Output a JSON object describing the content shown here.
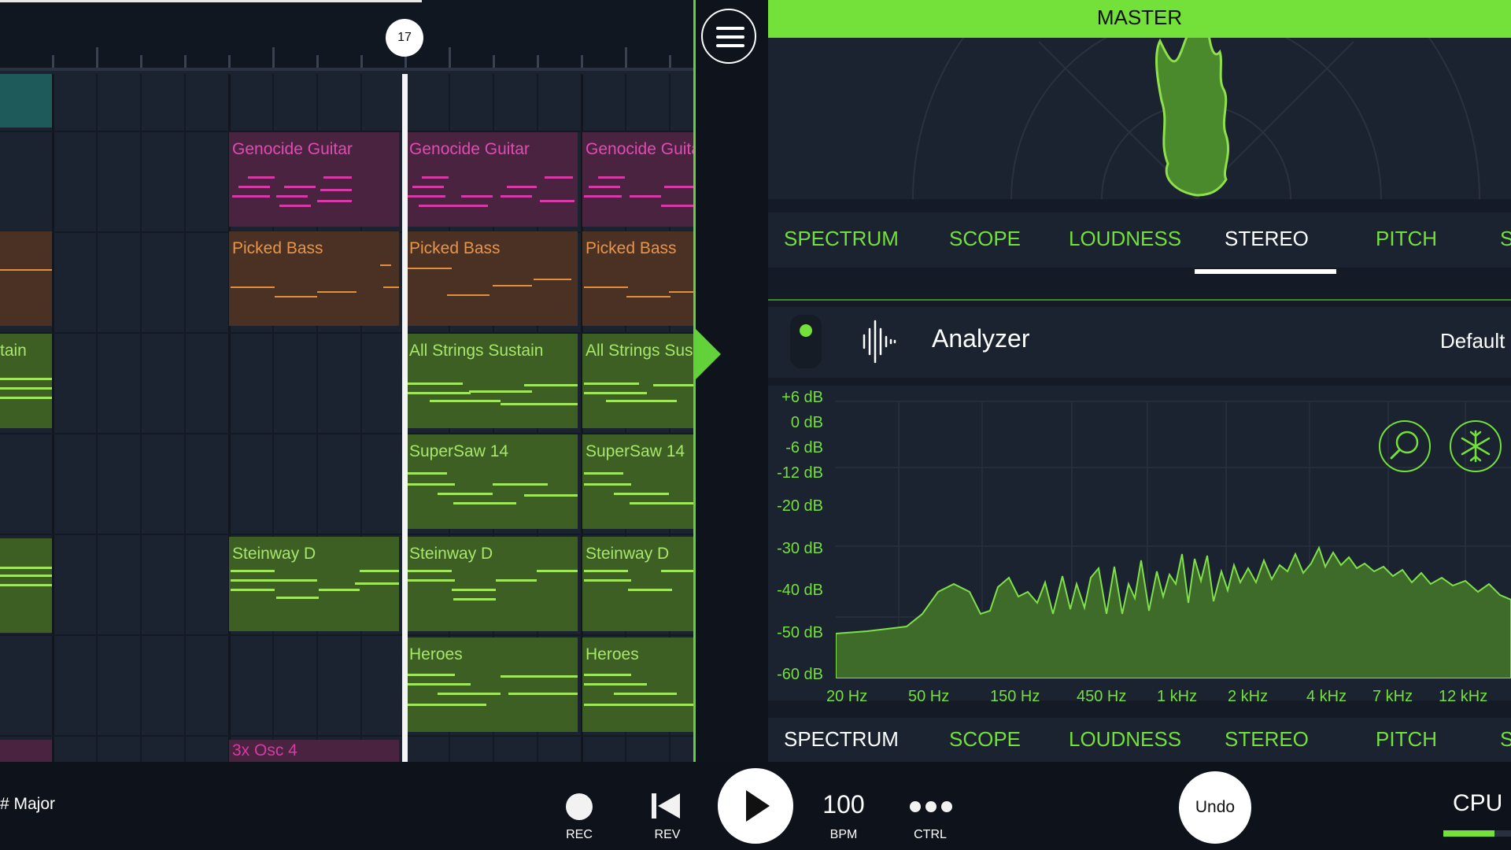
{
  "ruler": {
    "bar_marker": "17"
  },
  "tracks": {
    "lane_labels": [
      "tain"
    ],
    "clips": {
      "guitar": [
        "Genocide Guitar",
        "Genocide Guitar",
        "Genocide Guita"
      ],
      "bass": [
        "Picked Bass",
        "Picked Bass",
        "Picked Bass"
      ],
      "strings": [
        "All Strings Sustain",
        "All Strings Sus"
      ],
      "supersaw": [
        "SuperSaw 14",
        "SuperSaw 14"
      ],
      "piano": [
        "Steinway D",
        "Steinway D",
        "Steinway D"
      ],
      "heroes": [
        "Heroes",
        "Heroes"
      ],
      "osc": [
        "3x Osc 4"
      ]
    }
  },
  "master": {
    "title": "MASTER",
    "tabs": [
      "SPECTRUM",
      "SCOPE",
      "LOUDNESS",
      "STEREO",
      "PITCH",
      "S"
    ],
    "active_top_tab": "STEREO",
    "analyzer": {
      "title": "Analyzer",
      "preset": "Default",
      "db_scale": [
        "+6 dB",
        "0 dB",
        "-6 dB",
        "-12 dB",
        "-20 dB",
        "-30 dB",
        "-40 dB",
        "-50 dB",
        "-60 dB"
      ],
      "freq_scale": [
        "20 Hz",
        "50 Hz",
        "150 Hz",
        "450 Hz",
        "1 kHz",
        "2 kHz",
        "4 kHz",
        "7 kHz",
        "12 kHz"
      ]
    }
  },
  "transport": {
    "scale": "# Major",
    "rec_label": "REC",
    "rev_label": "REV",
    "bpm_value": "100",
    "bpm_label": "BPM",
    "ctrl_label": "CTRL",
    "undo_label": "Undo",
    "cpu_label": "CPU",
    "cpu_level_fraction": 0.75
  },
  "colors": {
    "accent": "#74e03a",
    "guitar": "#d63aa6",
    "bass": "#e08f40",
    "green_clip": "#9fe65a"
  }
}
